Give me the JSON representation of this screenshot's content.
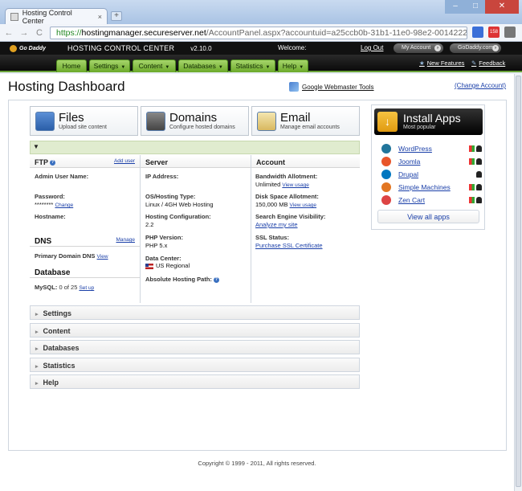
{
  "browser": {
    "tab_title": "Hosting Control Center",
    "tab_close": "×",
    "new_tab": "+",
    "url_scheme": "https://",
    "url_host": "hostingmanager.secureserver.net",
    "url_path": "/AccountPanel.aspx?accountuid=a25ccb0b-31b1-11e0-98e2-0014222113f2",
    "back": "←",
    "forward": "→",
    "reload": "C",
    "ext_badge": "158",
    "win_min": "–",
    "win_max": "□",
    "win_close": "✕"
  },
  "header": {
    "logo": "Go Daddy",
    "app_name": "HOSTING CONTROL CENTER",
    "version": "v2.10.0",
    "welcome": "Welcome:",
    "logout": "Log Out",
    "my_account": "My Account",
    "godaddy_link": "GoDaddy.com",
    "new_features": "New Features",
    "feedback": "Feedback"
  },
  "nav": [
    {
      "label": "Home",
      "arrow": ""
    },
    {
      "label": "Settings",
      "arrow": "▼"
    },
    {
      "label": "Content",
      "arrow": "▼"
    },
    {
      "label": "Databases",
      "arrow": "▼"
    },
    {
      "label": "Statistics",
      "arrow": "▼"
    },
    {
      "label": "Help",
      "arrow": "▼"
    }
  ],
  "page": {
    "title": "Hosting Dashboard",
    "webmaster_tools": "Google Webmaster Tools",
    "change_account": "(Change Account)"
  },
  "tiles": [
    {
      "title": "Files",
      "subtitle": "Upload site content",
      "icon": "files-icon"
    },
    {
      "title": "Domains",
      "subtitle": "Configure hosted domains",
      "icon": "domains-icon"
    },
    {
      "title": "Email",
      "subtitle": "Manage email accounts",
      "icon": "email-icon"
    }
  ],
  "collapse_marker": "▼",
  "ftp": {
    "heading": "FTP",
    "add_user": "Add user",
    "admin_label": "Admin User Name:",
    "password_label": "Password:",
    "password_value": "********",
    "change": "Change",
    "hostname_label": "Hostname:"
  },
  "dns": {
    "heading": "DNS",
    "manage": "Manage",
    "primary": "Primary Domain DNS",
    "view": "View"
  },
  "database": {
    "heading": "Database",
    "mysql": "MySQL:",
    "count": "0 of 25",
    "setup": "Set up"
  },
  "server": {
    "heading": "Server",
    "ip_label": "IP Address:",
    "os_label": "OS/Hosting Type:",
    "os_value": "Linux / 4GH Web Hosting",
    "config_label": "Hosting Configuration:",
    "config_value": "2.2",
    "php_label": "PHP Version:",
    "php_value": "PHP 5.x",
    "dc_label": "Data Center:",
    "dc_value": "US Regional",
    "path_label": "Absolute Hosting Path:"
  },
  "account": {
    "heading": "Account",
    "bw_label": "Bandwidth Allotment:",
    "bw_value": "Unlimited",
    "bw_link": "View usage",
    "disk_label": "Disk Space Allotment:",
    "disk_value": "150,000 MB",
    "disk_link": "View usage",
    "seo_label": "Search Engine Visibility:",
    "seo_link": "Analyze my site",
    "ssl_label": "SSL Status:",
    "ssl_link": "Purchase SSL Certificate"
  },
  "sections": [
    "Settings",
    "Content",
    "Databases",
    "Statistics",
    "Help"
  ],
  "section_chevron": "▸",
  "apps": {
    "title": "Install Apps",
    "subtitle": "Most popular",
    "icon_glyph": "↓",
    "items": [
      {
        "name": "WordPress",
        "color": "#21759b",
        "win": true
      },
      {
        "name": "Joomla",
        "color": "#e8562a",
        "win": true
      },
      {
        "name": "Drupal",
        "color": "#0077c0",
        "win": false
      },
      {
        "name": "Simple Machines",
        "color": "#e27622",
        "win": true
      },
      {
        "name": "Zen Cart",
        "color": "#d44",
        "win": true
      }
    ],
    "view_all": "View all apps"
  },
  "footer": "Copyright © 1999 - 2011, All rights reserved.",
  "help_glyph": "?"
}
